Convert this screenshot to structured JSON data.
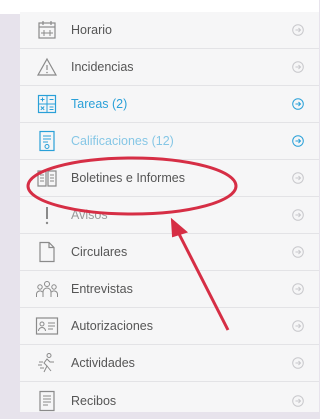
{
  "menu": {
    "items": [
      {
        "label": "Horario",
        "icon": "calendar-icon"
      },
      {
        "label": "Incidencias",
        "icon": "warning-icon"
      },
      {
        "label": "Tareas (2)",
        "icon": "calculator-icon"
      },
      {
        "label": "Calificaciones (12)",
        "icon": "report-card-icon"
      },
      {
        "label": "Boletines e Informes",
        "icon": "book-icon"
      },
      {
        "label": "Avisos",
        "icon": "exclamation-icon"
      },
      {
        "label": "Circulares",
        "icon": "document-icon"
      },
      {
        "label": "Entrevistas",
        "icon": "people-icon"
      },
      {
        "label": "Autorizaciones",
        "icon": "authorization-icon"
      },
      {
        "label": "Actividades",
        "icon": "activities-icon"
      },
      {
        "label": "Recibos",
        "icon": "receipt-icon"
      }
    ]
  },
  "colors": {
    "accent": "#2aa0d8",
    "annotation": "#d62e45",
    "text": "#555555"
  }
}
